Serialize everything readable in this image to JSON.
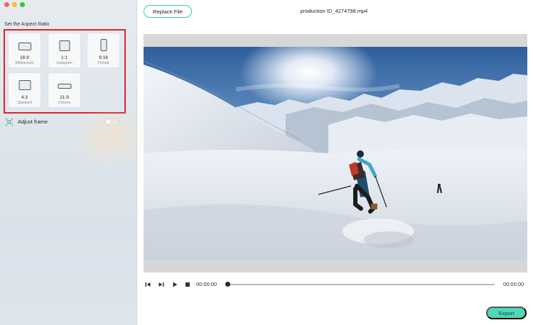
{
  "sidebar": {
    "section_title": "Set the Aspect Ratio",
    "ratios": [
      {
        "label": "16:9",
        "sub": "Widescreen",
        "selected": false
      },
      {
        "label": "1:1",
        "sub": "Instagram",
        "selected": false
      },
      {
        "label": "9:16",
        "sub": "Portrait",
        "selected": false
      },
      {
        "label": "4:3",
        "sub": "Standard",
        "selected": false
      },
      {
        "label": "21:9",
        "sub": "Cinema",
        "selected": false
      }
    ],
    "adjust_frame": {
      "label": "Adjust frame",
      "enabled": false
    }
  },
  "header": {
    "replace_label": "Replace File",
    "file_name": "production ID_4274798.mp4"
  },
  "player": {
    "current_time": "00:00:00",
    "total_time": "00:00:00",
    "progress": 0
  },
  "footer": {
    "export_label": "Export"
  },
  "colors": {
    "accent": "#3ac8a8",
    "export_bg": "#4fd8b7",
    "highlight_border": "#d9262c"
  },
  "icons": {
    "ratio_group": "aspect-ratio-shape-icons",
    "adjust": "crop-frame-icon",
    "controls": [
      "step-back-icon",
      "step-forward-icon",
      "play-icon",
      "stop-icon"
    ]
  }
}
